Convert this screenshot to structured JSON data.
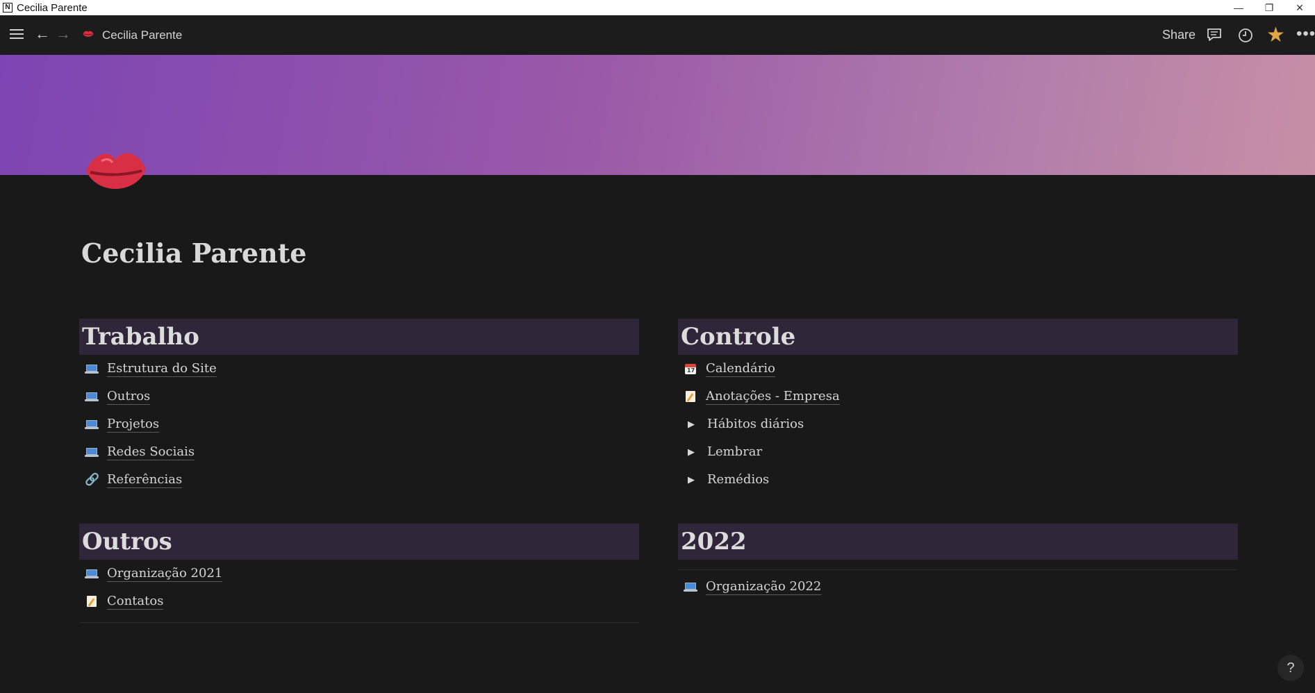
{
  "window": {
    "title": "Cecilia Parente"
  },
  "topbar": {
    "breadcrumb_title": "Cecilia Parente",
    "share_label": "Share",
    "accent_star": "#e0a544"
  },
  "page": {
    "title": "Cecilia Parente",
    "icon": "kiss-mark-icon",
    "cover_colors": [
      "#7d45b3",
      "#c78fa5"
    ]
  },
  "sections": {
    "trabalho": {
      "heading": "Trabalho",
      "items": [
        {
          "icon": "laptop-icon",
          "label": "Estrutura do Site"
        },
        {
          "icon": "laptop-icon",
          "label": "Outros"
        },
        {
          "icon": "laptop-icon",
          "label": "Projetos"
        },
        {
          "icon": "laptop-icon",
          "label": "Redes Sociais"
        },
        {
          "icon": "link-icon",
          "label": "Referências"
        }
      ]
    },
    "outros": {
      "heading": "Outros",
      "items": [
        {
          "icon": "laptop-icon",
          "label": "Organização 2021"
        },
        {
          "icon": "memo-icon",
          "label": "Contatos"
        }
      ]
    },
    "controle": {
      "heading": "Controle",
      "items": [
        {
          "icon": "calendar-icon",
          "label": "Calendário"
        },
        {
          "icon": "memo-icon",
          "label": "Anotações - Empresa"
        },
        {
          "icon": "toggle-arrow-icon",
          "label": "Hábitos diários"
        },
        {
          "icon": "toggle-arrow-icon",
          "label": "Lembrar"
        },
        {
          "icon": "toggle-arrow-icon",
          "label": "Remédios"
        }
      ]
    },
    "y2022": {
      "heading": "2022",
      "items": [
        {
          "icon": "laptop-icon",
          "label": "Organização 2022"
        }
      ]
    }
  },
  "help": {
    "label": "?"
  }
}
